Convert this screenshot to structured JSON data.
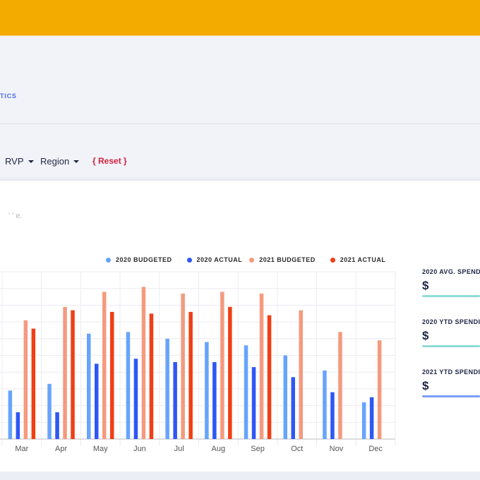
{
  "header": {
    "breadcrumb": "TICS",
    "brand_color": "#f3ab00"
  },
  "filters": {
    "items": [
      {
        "label": "RVP"
      },
      {
        "label": "Region"
      }
    ],
    "reset_label": "{ Reset }"
  },
  "panel": {
    "note": "' '  e."
  },
  "colors": {
    "budget_2020": "#67a4fc",
    "actual_2020": "#2e57f5",
    "budget_2021": "#f49a7e",
    "actual_2021": "#f03e15"
  },
  "chart_data": {
    "type": "bar",
    "title": "",
    "xlabel": "",
    "ylabel": "",
    "categories": [
      "Mar",
      "Apr",
      "May",
      "Jun",
      "Jul",
      "Aug",
      "Sep",
      "Oct",
      "Nov",
      "Dec"
    ],
    "ylim": [
      0,
      100
    ],
    "y_gridlines": 10,
    "grid": true,
    "legend_position": "top",
    "series": [
      {
        "name": "2020 BUDGETED",
        "color": "#67a4fc",
        "values": [
          29,
          33,
          63,
          64,
          60,
          58,
          56,
          50,
          41,
          22
        ]
      },
      {
        "name": "2020 ACTUAL",
        "color": "#2e57f5",
        "values": [
          16,
          16,
          45,
          48,
          46,
          46,
          43,
          37,
          28,
          25
        ]
      },
      {
        "name": "2021 BUDGETED",
        "color": "#f49a7e",
        "values": [
          71,
          79,
          88,
          91,
          87,
          88,
          87,
          77,
          64,
          59
        ]
      },
      {
        "name": "2021 ACTUAL",
        "color": "#f03e15",
        "values": [
          66,
          77,
          76,
          75,
          76,
          79,
          74,
          null,
          null,
          null
        ]
      }
    ]
  },
  "kpis": [
    {
      "label": "2020 AVG. SPENDI",
      "value": "$",
      "bar_color": "#8fdcd5"
    },
    {
      "label": "2020 YTD SPENDI",
      "value": "$",
      "bar_color": "#8fdcd5"
    },
    {
      "label": "2021 YTD SPENDI",
      "value": "$",
      "bar_color": "#7d9ef7"
    }
  ]
}
